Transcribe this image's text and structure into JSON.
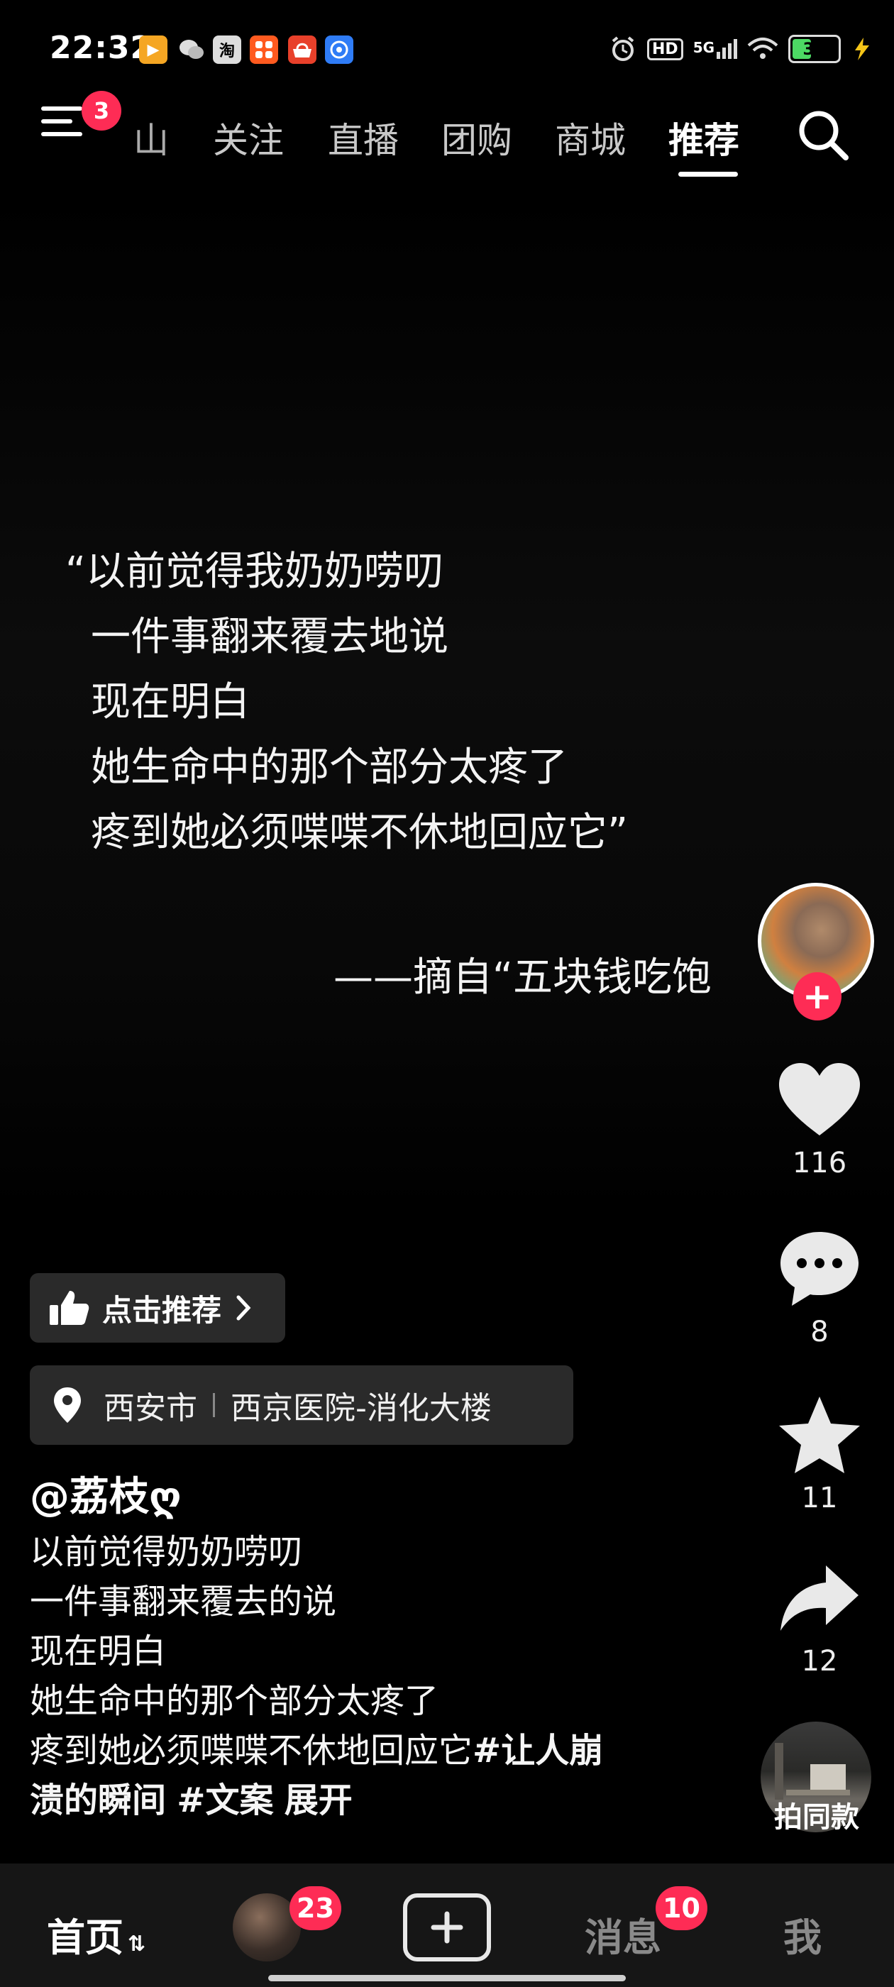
{
  "status_bar": {
    "time": "22:32",
    "app_icons": [
      "video-app-icon",
      "wechat-icon",
      "taobao-icon",
      "grid-app-icon",
      "shopping-app-icon",
      "browser-icon"
    ],
    "network_label": "5G",
    "hd_label": "HD",
    "battery_level": "38",
    "battery_percent": 38
  },
  "top_nav": {
    "menu_badge": "3",
    "tabs": [
      "山",
      "关注",
      "直播",
      "团购",
      "商城",
      "推荐"
    ],
    "active_tab": "推荐"
  },
  "video": {
    "quote_lines": [
      "“以前觉得我奶奶唠叨",
      "一件事翻来覆去地说",
      "现在明白",
      "她生命中的那个部分太疼了",
      "疼到她必须喋喋不休地回应它”"
    ],
    "source": "——摘自“五块钱吃饱"
  },
  "actions": {
    "follow_label": "+",
    "likes": "116",
    "comments": "8",
    "favorites": "11",
    "shares": "12",
    "same_style_label": "拍同款"
  },
  "info": {
    "recommend_label": "点击推荐",
    "location_city": "西安市",
    "location_place": "西京医院-消化大楼",
    "author": "@荔枝ღ",
    "desc_lines": [
      "以前觉得奶奶唠叨",
      "一件事翻来覆去的说",
      "现在明白",
      "她生命中的那个部分太疼了"
    ],
    "desc_line5_text": "疼到她必须喋喋不休地回应它",
    "hashtag1_part1": "#让人崩",
    "hashtag1_part2": "溃的瞬间",
    "hashtag2": "#文案",
    "expand_label": "展开"
  },
  "bottom_nav": {
    "home": "首页",
    "friends_badge": "23",
    "messages": "消息",
    "messages_badge": "10",
    "me": "我"
  },
  "colors": {
    "accent": "#fe2c55",
    "background": "#000000",
    "chip_bg": "#2a2a2a"
  }
}
